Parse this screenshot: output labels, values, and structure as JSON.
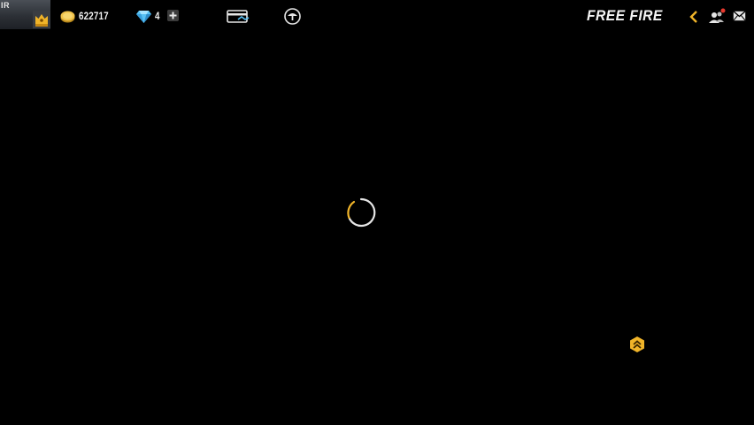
{
  "profile": {
    "avatar_label": "IR"
  },
  "currency": {
    "coins": "622717",
    "diamonds": "4"
  },
  "brand": {
    "logo_text": "FREE FIRE"
  },
  "colors": {
    "gold": "#f0b429",
    "diamond": "#57c1f5",
    "badge_red": "#e8392e",
    "background": "#000000"
  },
  "icons": {
    "coin": "coin-icon",
    "diamond": "diamond-icon",
    "plus": "plus-icon",
    "card": "card-icon",
    "kiosk": "kiosk-icon",
    "back": "back-chevron-icon",
    "friends": "friends-icon",
    "mail": "mail-icon",
    "spinner": "loading-spinner-icon",
    "rank_up": "rank-up-icon"
  }
}
